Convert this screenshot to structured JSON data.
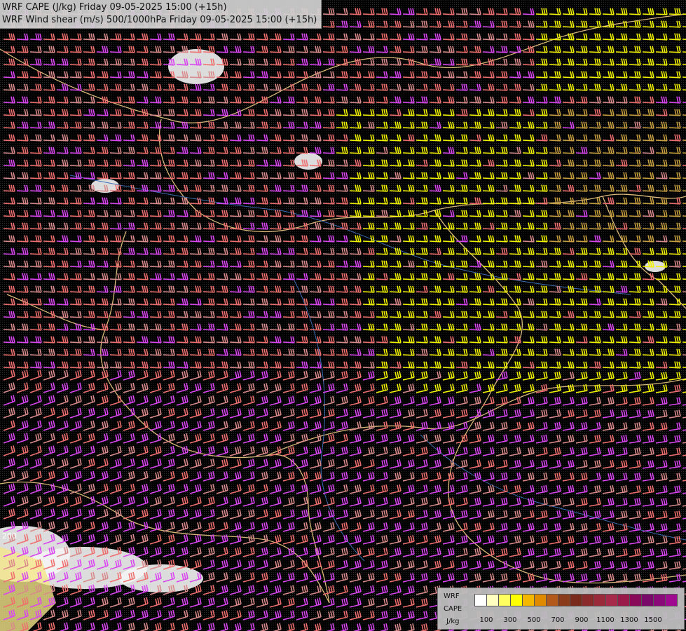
{
  "header": {
    "line1": "WRF CAPE (J/kg) Friday 09-05-2025 15:00 (+15h)",
    "line2": "WRF Wind shear (m/s) 500/1000hPa Friday 09-05-2025 15:00 (+15h)"
  },
  "map": {
    "background": "#000000",
    "barb_colors": [
      "#d946ef",
      "#ef6f6f",
      "#d98a8a",
      "#f2f200",
      "#c8a040"
    ],
    "border_color": "#d9b87a",
    "river_color": "#3b6db3",
    "cape_contour_label": "200"
  },
  "legend": {
    "model": "WRF",
    "field": "CAPE",
    "unit": "J/kg",
    "colors": [
      "#ffffff",
      "#ffffc0",
      "#ffff60",
      "#ffff00",
      "#f5b800",
      "#e08a00",
      "#b35a1a",
      "#8a3c1a",
      "#7a2a1a",
      "#8a2a2a",
      "#9a2a3a",
      "#a82a4a",
      "#9a1a4a",
      "#8a0a5a",
      "#7a0a6a",
      "#8a0a7a",
      "#a00a90"
    ],
    "ticks": [
      "100",
      "300",
      "500",
      "700",
      "900",
      "1100",
      "1300",
      "1500"
    ]
  }
}
